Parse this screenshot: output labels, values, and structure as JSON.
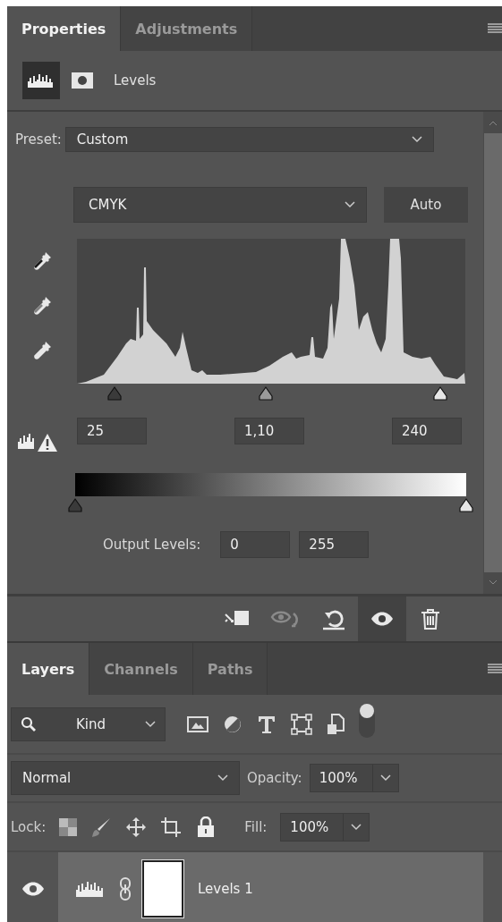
{
  "properties_panel": {
    "tabs": [
      {
        "label": "Properties",
        "selected": true
      },
      {
        "label": "Adjustments",
        "selected": false
      }
    ],
    "mode_buttons": [
      {
        "kind": "adjustment",
        "selected": true
      },
      {
        "kind": "mask",
        "selected": false
      }
    ],
    "title": "Levels",
    "preset": {
      "label": "Preset:",
      "value": "Custom"
    },
    "channel": {
      "value": "CMYK"
    },
    "auto_button": "Auto",
    "input_levels": {
      "sliders": [
        {
          "kind": "black",
          "level": 0.097
        },
        {
          "kind": "gray",
          "level": 0.486
        },
        {
          "kind": "white",
          "level": 0.935
        }
      ],
      "fields": [
        "25",
        "1,10",
        "240"
      ]
    },
    "output_levels": {
      "label": "Output Levels:",
      "sliders": [
        {
          "kind": "black",
          "level": 0
        },
        {
          "kind": "white",
          "level": 1
        }
      ],
      "fields": [
        "0",
        "255"
      ]
    },
    "footer_buttons": [
      {
        "kind": "clip",
        "selected": false,
        "disabled": false
      },
      {
        "kind": "previous-state",
        "selected": false,
        "disabled": true
      },
      {
        "kind": "reset",
        "selected": false,
        "disabled": false
      },
      {
        "kind": "visibility",
        "selected": true,
        "disabled": false
      },
      {
        "kind": "delete",
        "selected": false,
        "disabled": false
      }
    ]
  },
  "layers_panel": {
    "tabs": [
      {
        "label": "Layers",
        "selected": true
      },
      {
        "label": "Channels",
        "selected": false
      },
      {
        "label": "Paths",
        "selected": false
      }
    ],
    "filter": {
      "value": "Kind",
      "on": true
    },
    "blend_mode": "Normal",
    "opacity": {
      "label": "Opacity:",
      "value": "100%"
    },
    "lock": {
      "label": "Lock:"
    },
    "fill": {
      "label": "Fill:",
      "value": "100%"
    },
    "layers": [
      {
        "name": "Levels 1",
        "visible": true
      }
    ]
  }
}
